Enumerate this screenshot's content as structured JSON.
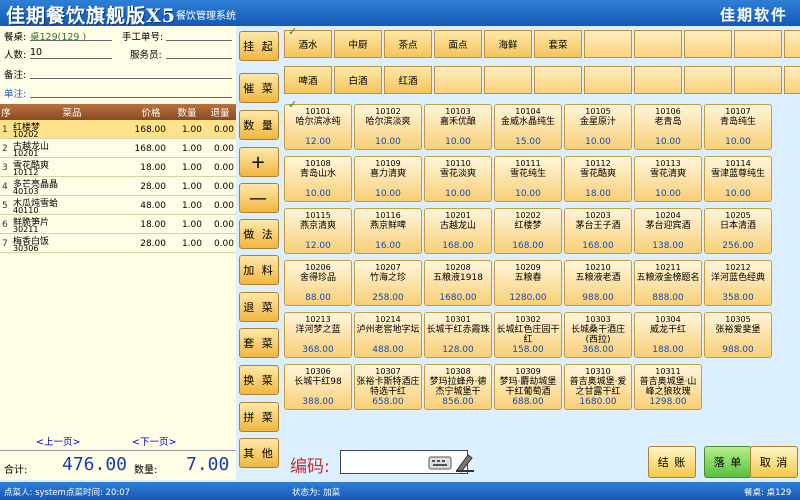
{
  "app": {
    "title": "佳期餐饮旗舰版X5",
    "subtitle": "餐饮管理系统",
    "company": "佳期软件"
  },
  "order": {
    "table_label": "餐桌:",
    "table_value": "桌129(129 )",
    "manual_label": "手工单号:",
    "people_label": "人数:",
    "people_value": "10",
    "waiter_label": "服务员:",
    "note_label": "备注:",
    "remark_label": "单注:"
  },
  "table_header": {
    "no": "序",
    "name": "菜品",
    "price": "价格",
    "qty": "数量",
    "ret": "退量"
  },
  "rows": [
    {
      "no": "1",
      "name": "红楼梦",
      "code": "10202",
      "price": "168.00",
      "qty": "1.00",
      "ret": "0.00"
    },
    {
      "no": "2",
      "name": "古越龙山",
      "code": "10201",
      "price": "168.00",
      "qty": "1.00",
      "ret": "0.00"
    },
    {
      "no": "3",
      "name": "雪花酷爽",
      "code": "10112",
      "price": "18.00",
      "qty": "1.00",
      "ret": "0.00"
    },
    {
      "no": "4",
      "name": "多芒亮晶晶",
      "code": "40103",
      "price": "28.00",
      "qty": "1.00",
      "ret": "0.00"
    },
    {
      "no": "5",
      "name": "木瓜炖雪蛤",
      "code": "40110",
      "price": "48.00",
      "qty": "1.00",
      "ret": "0.00"
    },
    {
      "no": "6",
      "name": "鲜脆笋片",
      "code": "30211",
      "price": "18.00",
      "qty": "1.00",
      "ret": "0.00"
    },
    {
      "no": "7",
      "name": "梅香白饭",
      "code": "30306",
      "price": "28.00",
      "qty": "1.00",
      "ret": "0.00"
    }
  ],
  "pager": {
    "prev": "<上一页>",
    "next": "<下一页>"
  },
  "totals": {
    "total_label": "合计:",
    "total_value": "476.00",
    "qty_label": "数量:",
    "qty_value": "7.00"
  },
  "side_buttons": [
    "挂 起",
    "催 菜",
    "数 量",
    "+",
    "—",
    "做 法",
    "加 料",
    "退 菜",
    "套 菜",
    "换 菜",
    "拼 菜",
    "其 他"
  ],
  "categories_row1": [
    "酒水",
    "中厨",
    "茶点",
    "面点",
    "海鲜",
    "套菜",
    "",
    "",
    "",
    "",
    ""
  ],
  "categories_row2": [
    "啤酒",
    "白酒",
    "红酒",
    "",
    "",
    "",
    "",
    "",
    "",
    "",
    ""
  ],
  "check_mark": "✓",
  "dishes": [
    {
      "code": "10101",
      "name": "哈尔滨冰纯",
      "price": "12.00"
    },
    {
      "code": "10102",
      "name": "哈尔滨淡爽",
      "price": "10.00"
    },
    {
      "code": "10103",
      "name": "嘉禾优酿",
      "price": "10.00"
    },
    {
      "code": "10104",
      "name": "金威水晶纯生",
      "price": "15.00"
    },
    {
      "code": "10105",
      "name": "金星原汁",
      "price": "10.00"
    },
    {
      "code": "10106",
      "name": "老青岛",
      "price": "10.00"
    },
    {
      "code": "10107",
      "name": "青岛纯生",
      "price": "10.00"
    },
    {
      "code": "10108",
      "name": "青岛山水",
      "price": "10.00"
    },
    {
      "code": "10109",
      "name": "喜力清爽",
      "price": "10.00"
    },
    {
      "code": "10110",
      "name": "雪花淡爽",
      "price": "10.00"
    },
    {
      "code": "10111",
      "name": "雪花纯生",
      "price": "10.00"
    },
    {
      "code": "10112",
      "name": "雪花酷爽",
      "price": "18.00"
    },
    {
      "code": "10113",
      "name": "雪花清爽",
      "price": "10.00"
    },
    {
      "code": "10114",
      "name": "雪津蓝尊纯生",
      "price": "10.00"
    },
    {
      "code": "10115",
      "name": "燕京清爽",
      "price": "12.00"
    },
    {
      "code": "10116",
      "name": "燕京鲜啤",
      "price": "16.00"
    },
    {
      "code": "10201",
      "name": "古越龙山",
      "price": "168.00"
    },
    {
      "code": "10202",
      "name": "红楼梦",
      "price": "168.00"
    },
    {
      "code": "10203",
      "name": "茅台王子酒",
      "price": "168.00"
    },
    {
      "code": "10204",
      "name": "茅台迎宾酒",
      "price": "138.00"
    },
    {
      "code": "10205",
      "name": "日本清酒",
      "price": "256.00"
    },
    {
      "code": "10206",
      "name": "舍得珍品",
      "price": "88.00"
    },
    {
      "code": "10207",
      "name": "竹海之珍",
      "price": "258.00"
    },
    {
      "code": "10208",
      "name": "五粮液1918",
      "price": "1680.00"
    },
    {
      "code": "10209",
      "name": "五粮春",
      "price": "1280.00"
    },
    {
      "code": "10210",
      "name": "五粮液老酒",
      "price": "988.00"
    },
    {
      "code": "10211",
      "name": "五粮液金榜题名",
      "price": "888.00"
    },
    {
      "code": "10212",
      "name": "洋河蓝色经典",
      "price": "358.00"
    },
    {
      "code": "10213",
      "name": "洋河梦之蓝",
      "price": "368.00"
    },
    {
      "code": "10214",
      "name": "泸州老窖地字坛",
      "price": "488.00"
    },
    {
      "code": "10301",
      "name": "长城干红赤霞珠",
      "price": "128.00"
    },
    {
      "code": "10302",
      "name": "长城红色庄园干红",
      "price": "158.00"
    },
    {
      "code": "10303",
      "name": "长城桑干酒庄(西拉)",
      "price": "368.00"
    },
    {
      "code": "10304",
      "name": "威龙干红",
      "price": "188.00"
    },
    {
      "code": "10305",
      "name": "张裕爱斐堡",
      "price": "988.00"
    },
    {
      "code": "10306",
      "name": "长城干红98",
      "price": "388.00"
    },
    {
      "code": "10307",
      "name": "张裕卡斯特酒庄特选干红",
      "price": "658.00"
    },
    {
      "code": "10308",
      "name": "梦玛拉蜂舟·德杰宁城堡干",
      "price": "856.00"
    },
    {
      "code": "10309",
      "name": "梦玛·麝劫城堡干红葡萄酒",
      "price": "688.00"
    },
    {
      "code": "10310",
      "name": "普吉奥城堡·爱之甘露干红",
      "price": "1680.00"
    },
    {
      "code": "10311",
      "name": "普吉奥城堡·山峰之狼玫瑰",
      "price": "1298.00"
    }
  ],
  "bottom": {
    "code_label": "编码:",
    "checkout": "结 账",
    "place_order": "落 单",
    "cancel": "取 消"
  },
  "status": {
    "user": "点菜人: system",
    "time": "点菜时间: 20:07",
    "state": "状态为: 加菜",
    "table": "餐桌: 桌129"
  },
  "colors": {
    "header_blue": "#1659b5",
    "button_yellow": "#f0b640",
    "order_green": "#58c040"
  }
}
